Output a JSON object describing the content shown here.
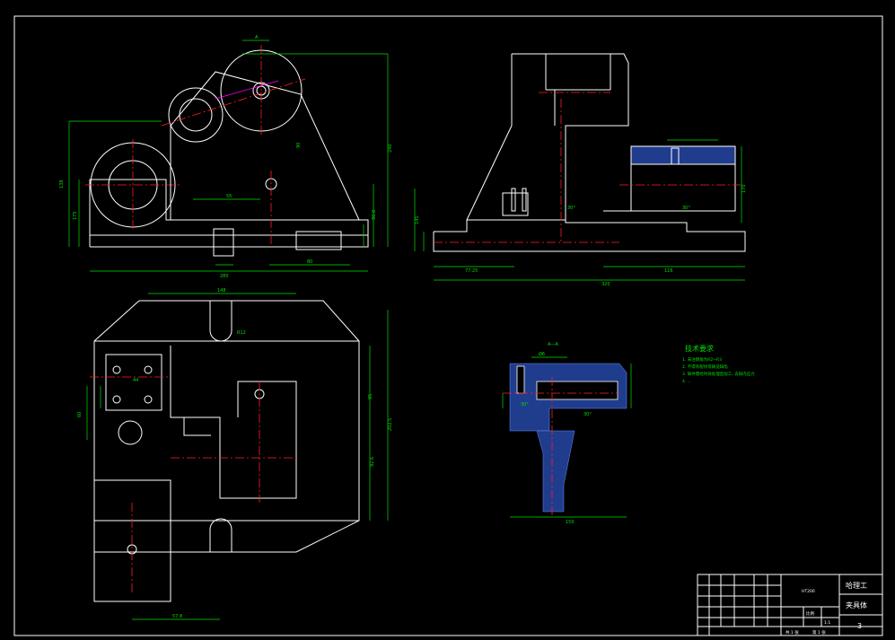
{
  "drawing": {
    "section_label_top": "A",
    "section_view_title": "A—A",
    "tech_req_title": "技术要求",
    "tech_req_lines": [
      "1. 未注倒角为R2~R3",
      "2. 不得有裂纹等铸造缺陷",
      "3. 铸件需经时效处理后加工, 去除内应力",
      "4. ..."
    ]
  },
  "dimensions": {
    "front": [
      "280",
      "138",
      "175",
      "90",
      "240",
      "55",
      "90.8",
      "155",
      "220",
      "80"
    ],
    "side": [
      "320",
      "116",
      "145",
      "170",
      "30°",
      "30°",
      "77.25"
    ],
    "top": [
      "148",
      "R12",
      "44",
      "60",
      "95",
      "202.5",
      "92.6",
      "57.8",
      "R12"
    ],
    "section": [
      "150",
      "30°",
      "30°",
      "Ø6"
    ]
  },
  "title_block": {
    "company": "哈理工",
    "drawing_name": "夹具体",
    "sheet_no": "3",
    "material": "HT200",
    "scale_label": "比例",
    "scale": "1:1",
    "sheet_info_1": "共 1 张",
    "sheet_info_2": "第 1 张"
  },
  "colors": {
    "background": "#000000",
    "outline": "#ffffff",
    "dimension": "#00e000",
    "centerline": "#ff2020",
    "hatch": "#203c8c"
  }
}
